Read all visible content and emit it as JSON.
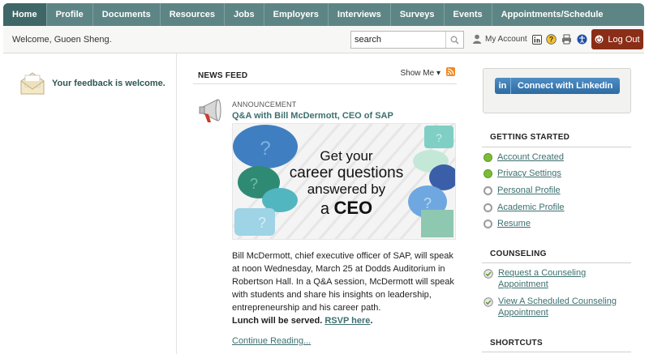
{
  "nav": {
    "tabs": [
      {
        "label": "Home",
        "active": true
      },
      {
        "label": "Profile"
      },
      {
        "label": "Documents"
      },
      {
        "label": "Resources"
      },
      {
        "label": "Jobs"
      },
      {
        "label": "Employers"
      },
      {
        "label": "Interviews"
      },
      {
        "label": "Surveys"
      },
      {
        "label": "Events"
      },
      {
        "label": "Appointments/Schedule"
      }
    ]
  },
  "utility": {
    "welcome": "Welcome, Guoen Sheng.",
    "search_value": "search",
    "my_account": "My Account",
    "logout": "Log Out"
  },
  "left": {
    "feedback": "Your feedback is welcome."
  },
  "feed": {
    "title": "NEWS FEED",
    "show_me": "Show Me",
    "post": {
      "kind": "ANNOUNCEMENT",
      "title": "Q&A with Bill McDermott, CEO of SAP",
      "banner_line1": "Get your",
      "banner_line2": "career questions",
      "banner_line3": "answered by",
      "banner_line4_prefix": "a ",
      "banner_line4_strong": "CEO",
      "body": "Bill McDermott, chief executive officer of SAP, will speak at noon Wednesday, March 25 at Dodds Auditorium in Robertson Hall. In a Q&A session, McDermott will speak with students and share his insights on leadership, entrepreneurship and his career path.",
      "lunch_text": "Lunch will be served.",
      "rsvp": "RSVP here",
      "lunch_period": ".",
      "continue": "Continue Reading..."
    }
  },
  "right": {
    "linkedin_logo": "in",
    "linkedin": "Connect with Linkedin",
    "getting_started": {
      "title": "GETTING STARTED",
      "items": [
        {
          "label": "Account Created",
          "done": true
        },
        {
          "label": "Privacy Settings",
          "done": true
        },
        {
          "label": "Personal Profile",
          "done": false
        },
        {
          "label": "Academic Profile",
          "done": false
        },
        {
          "label": "Resume",
          "done": false
        }
      ]
    },
    "counseling": {
      "title": "COUNSELING",
      "items": [
        {
          "label": "Request a Counseling Appointment"
        },
        {
          "label": "View A Scheduled Counseling Appointment"
        }
      ]
    },
    "shortcuts": {
      "title": "SHORTCUTS"
    }
  },
  "colors": {
    "nav_bg": "#5e8585",
    "nav_active": "#3f6767",
    "link": "#3d6f6f",
    "logout_bg": "#8a2e18",
    "linkedin": "#2c6aa3"
  }
}
